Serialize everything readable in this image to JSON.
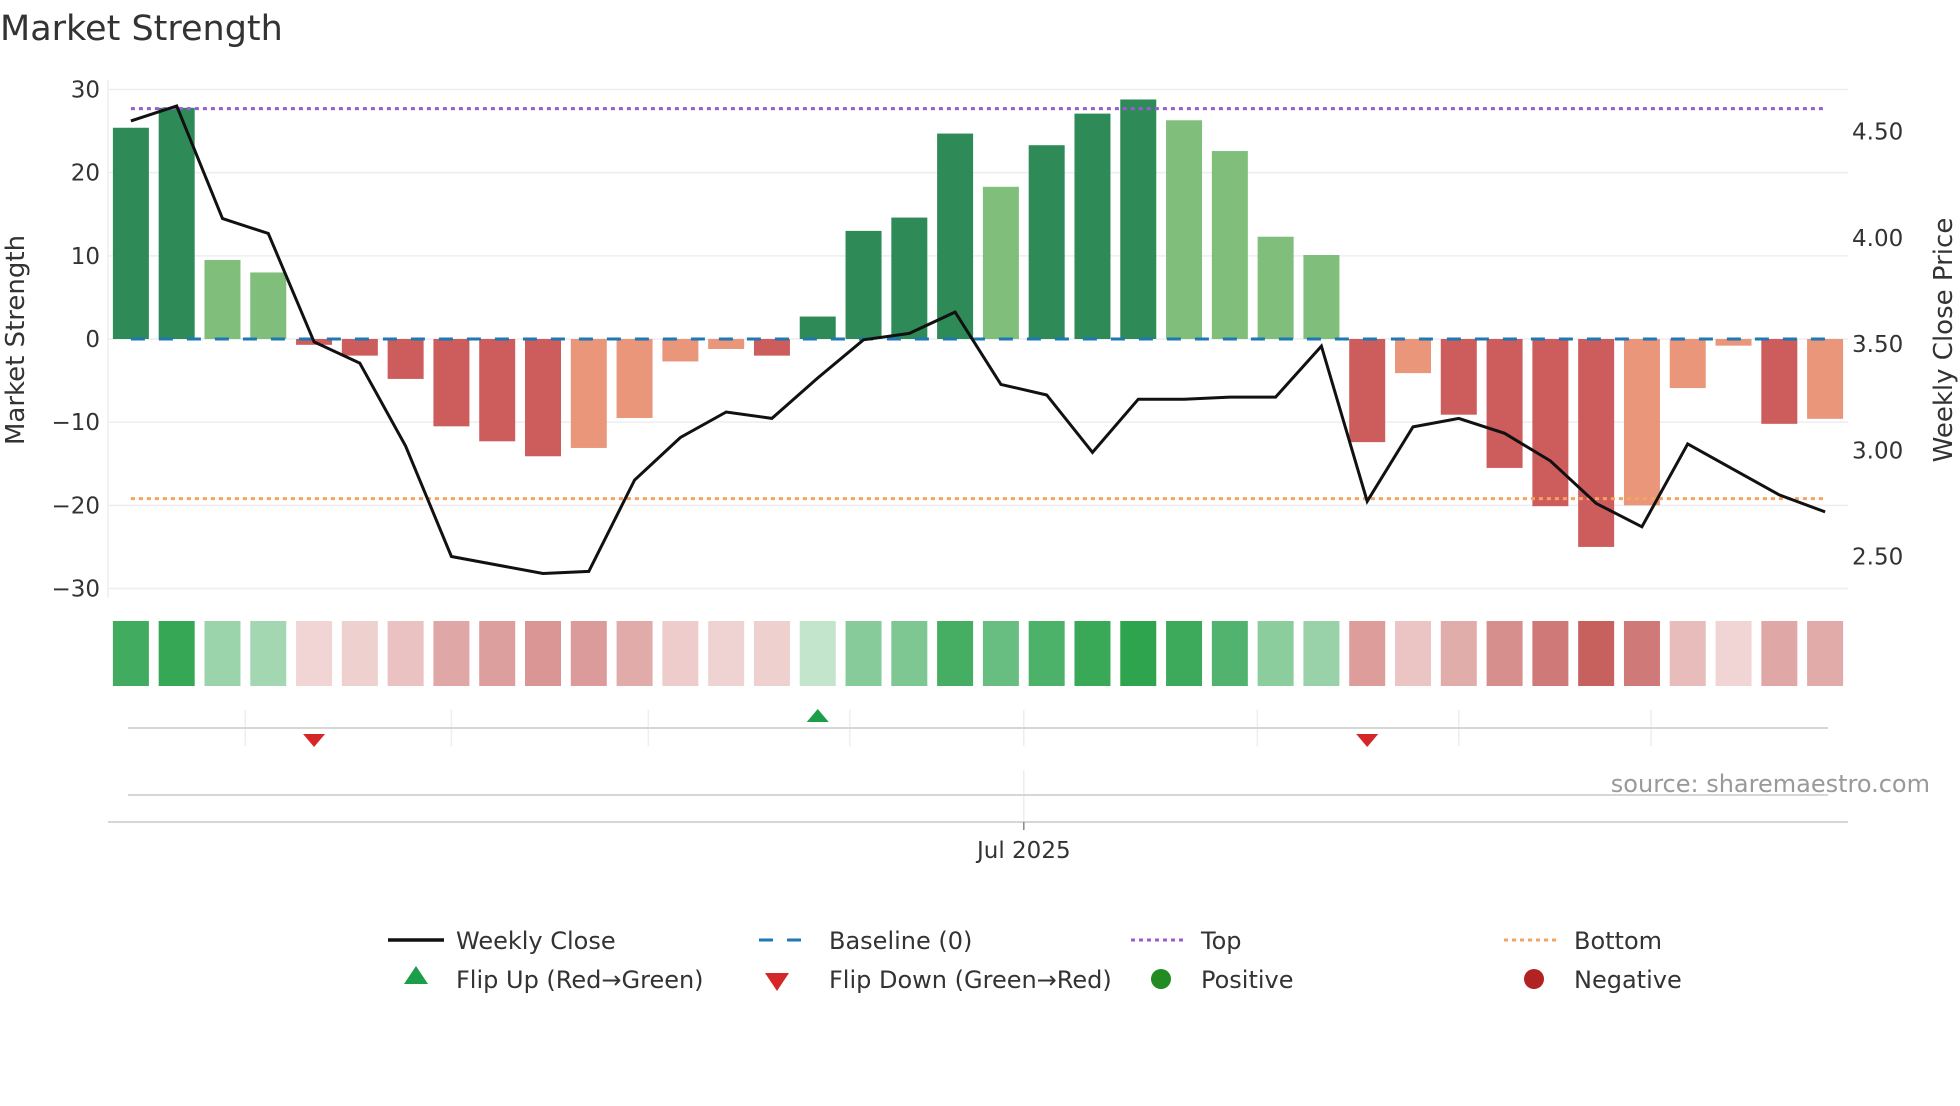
{
  "title": "Market Strength",
  "source": "source: sharemaestro.com",
  "colors": {
    "strong_positive": "#2e8b57",
    "weak_positive": "#7fbf7b",
    "strong_negative": "#cd5c5c",
    "weak_negative": "#e9967a",
    "heat_positive": "#2ea44f",
    "heat_negative": "#c0504d",
    "close_line": "#111111",
    "baseline": "#1f77b4",
    "top": "#9b59d6",
    "bottom": "#f4a460",
    "flip_up": "#1a9e4a",
    "flip_down": "#d62728",
    "positive_dot": "#228b22",
    "negative_dot": "#b22222"
  },
  "chart_data": {
    "type": "bar",
    "title": "Market Strength",
    "ylabel": "Market Strength",
    "y2label": "Weekly Close Price",
    "ylim": [
      -30,
      30
    ],
    "y_ticks": [
      "30",
      "20",
      "10",
      "0",
      "−10",
      "−20",
      "−30"
    ],
    "y2lim": [
      2.5,
      4.5
    ],
    "y2_ticks": [
      "4.50",
      "4.00",
      "3.50",
      "3.00",
      "2.50"
    ],
    "x_tick_label": "Jul 2025",
    "x_tick_index": 19.5,
    "strength": [
      25.4,
      27.8,
      9.5,
      8.0,
      -0.7,
      -2.0,
      -4.8,
      -10.5,
      -12.3,
      -14.1,
      -13.1,
      -9.5,
      -2.7,
      -1.2,
      -2.0,
      2.7,
      13.0,
      14.6,
      24.7,
      18.3,
      23.3,
      27.1,
      28.8,
      26.3,
      22.6,
      12.3,
      10.1,
      -12.4,
      -4.1,
      -9.1,
      -15.5,
      -20.1,
      -25.0,
      -20.0,
      -5.9,
      -0.8,
      -10.2,
      -9.6
    ],
    "shade": [
      "strong",
      "strong",
      "weak",
      "weak",
      "strong",
      "strong",
      "strong",
      "strong",
      "strong",
      "strong",
      "weak",
      "weak",
      "weak",
      "weak",
      "strong",
      "strong",
      "strong",
      "strong",
      "strong",
      "weak",
      "strong",
      "strong",
      "strong",
      "weak",
      "weak",
      "weak",
      "weak",
      "strong",
      "weak",
      "strong",
      "strong",
      "strong",
      "strong",
      "weak",
      "weak",
      "weak",
      "strong",
      "weak"
    ],
    "weekly_close": [
      4.55,
      4.62,
      4.09,
      4.02,
      3.51,
      3.41,
      3.02,
      2.5,
      2.46,
      2.42,
      2.43,
      2.86,
      3.06,
      3.18,
      3.15,
      3.34,
      3.52,
      3.55,
      3.65,
      3.31,
      3.26,
      2.99,
      3.24,
      3.24,
      3.25,
      3.25,
      3.49,
      2.76,
      3.11,
      3.15,
      3.08,
      2.95,
      2.75,
      2.64,
      3.03,
      2.91,
      2.79,
      2.71
    ],
    "baseline": 0,
    "top": 27.7,
    "bottom": -19.2,
    "flips": [
      {
        "index": 4,
        "direction": "down"
      },
      {
        "index": 15,
        "direction": "up"
      },
      {
        "index": 27,
        "direction": "down"
      }
    ],
    "month_grid_index": [
      2.5,
      7,
      11.3,
      15.7,
      19.5,
      24.6,
      29,
      33.2
    ],
    "legend": {
      "weekly_close": "Weekly Close",
      "baseline": "Baseline (0)",
      "top": "Top",
      "bottom": "Bottom",
      "flip_up": "Flip Up (Red→Green)",
      "flip_down": "Flip Down (Green→Red)",
      "positive": "Positive",
      "negative": "Negative"
    },
    "legend_position": "bottom"
  }
}
